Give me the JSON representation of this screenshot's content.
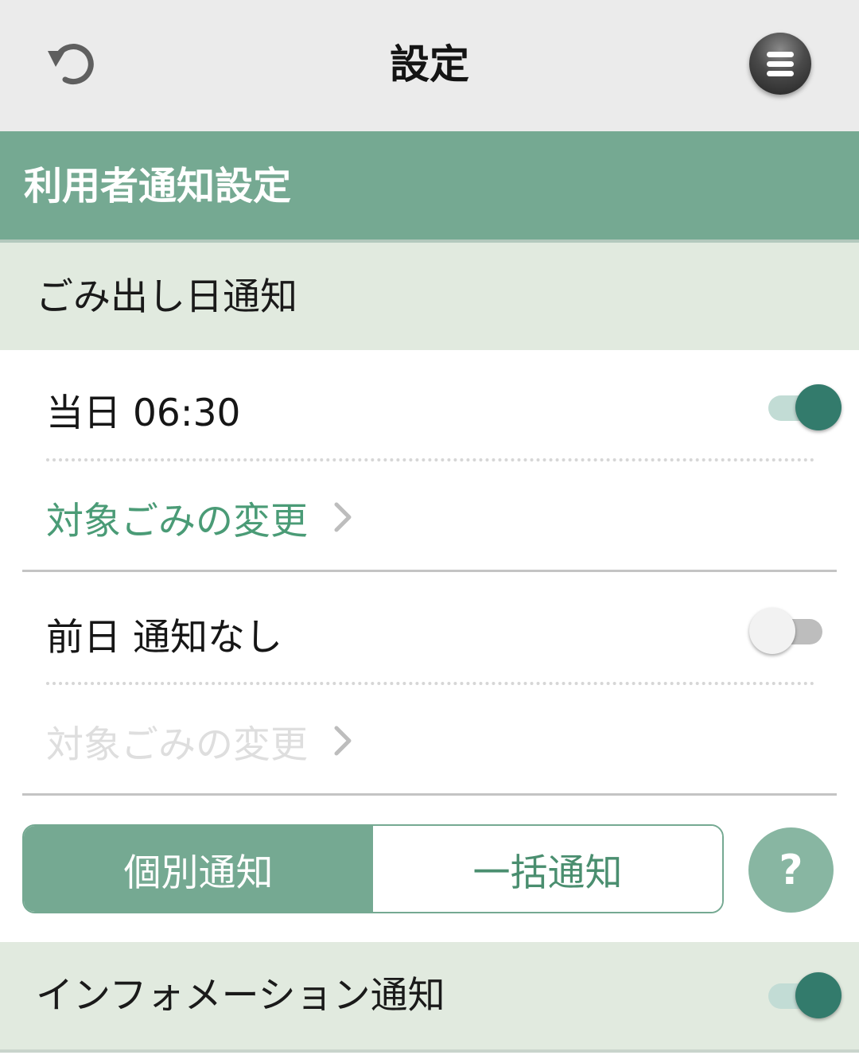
{
  "header": {
    "title": "設定",
    "back_icon": "undo-arrow-icon",
    "menu_icon": "hamburger-menu-icon"
  },
  "section": {
    "title": "利用者通知設定"
  },
  "garbage_notification": {
    "title": "ごみ出し日通知",
    "same_day": {
      "label": "当日 06:30",
      "enabled": true,
      "link_label": "対象ごみの変更"
    },
    "previous_day": {
      "label": "前日 通知なし",
      "enabled": false,
      "link_label": "対象ごみの変更"
    }
  },
  "mode_selector": {
    "options": [
      "個別通知",
      "一括通知"
    ],
    "selected": "個別通知"
  },
  "help_button": {
    "label": "?"
  },
  "information_notification": {
    "label": "インフォメーション通知",
    "enabled": true
  },
  "colors": {
    "accent": "#75a992",
    "toggle_on_knob": "#337b6c",
    "link": "#4a9b76",
    "sub_header_bg": "#e1eadf"
  }
}
